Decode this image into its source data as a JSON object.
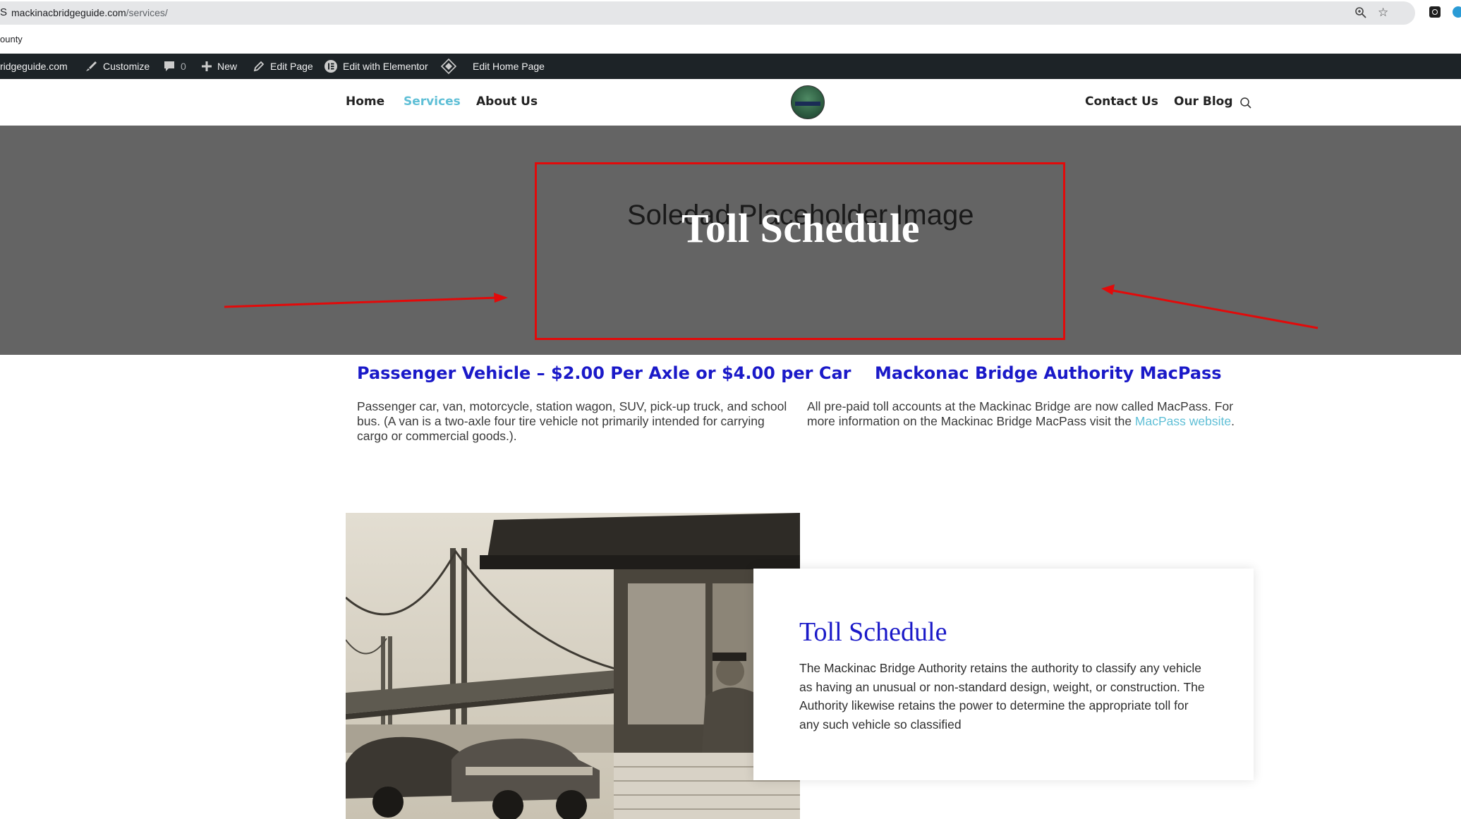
{
  "browser": {
    "url_host": "mackinacbridgeguide.com",
    "url_path": "/services/",
    "url_lead": "S",
    "bookmark_text": "ounty"
  },
  "admin_bar": {
    "site": "ridgeguide.com",
    "customize": "Customize",
    "comments_count": "0",
    "new": "New",
    "edit_page": "Edit Page",
    "edit_elementor": "Edit with Elementor",
    "edit_home": "Edit Home Page"
  },
  "nav": {
    "home": "Home",
    "services": "Services",
    "about": "About Us",
    "contact": "Contact Us",
    "blog": "Our Blog"
  },
  "hero": {
    "placeholder_text": "Soledad Placeholder Image",
    "title": "Toll Schedule"
  },
  "passenger": {
    "title": "Passenger Vehicle – $2.00 Per Axle or $4.00 per Car",
    "text": "Passenger car, van, motorcycle, station wagon, SUV, pick-up truck, and school bus. (A van is a two-axle four tire vehicle not primarily intended for carrying cargo or commercial goods.)."
  },
  "macpass": {
    "title": "Mackonac Bridge Authority MacPass",
    "text_before": "All pre-paid toll accounts at the Mackinac Bridge are now called MacPass. For more information on the Mackinac Bridge MacPass visit the ",
    "link": "MacPass website",
    "text_after": "."
  },
  "card": {
    "title": "Toll Schedule",
    "text": "The Mackinac Bridge Authority retains the authority to classify any vehicle as having an unusual or non-standard design, weight, or construction. The Authority likewise retains the power to determine the appropriate toll for any such vehicle so classified"
  },
  "colors": {
    "accent_blue": "#1a19c8",
    "link_teal": "#5fbfd6",
    "annotation_red": "#e20a0a",
    "hero_gray": "#646464",
    "admin_bar": "#1d2327"
  }
}
